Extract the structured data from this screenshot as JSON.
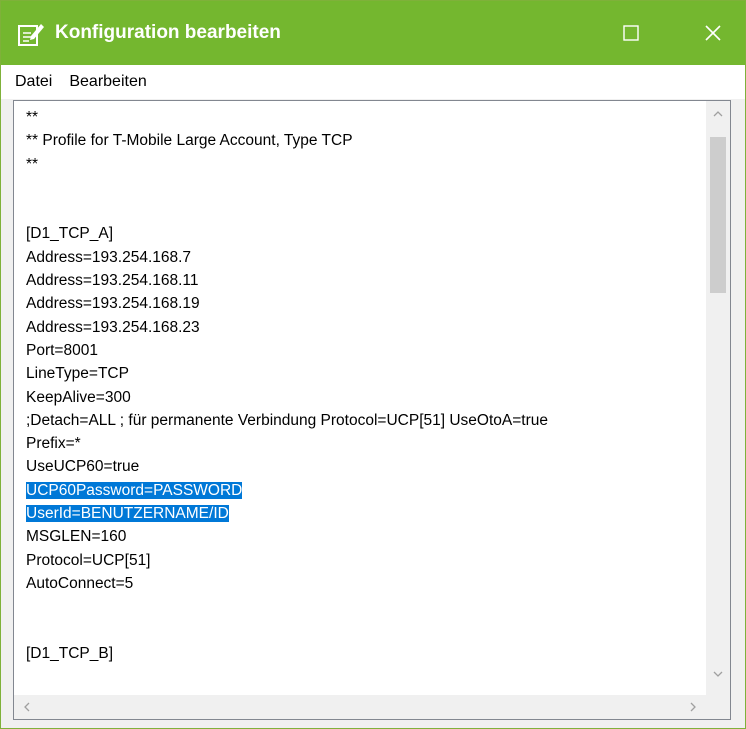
{
  "window": {
    "title": "Konfiguration bearbeiten",
    "accent_color": "#74b72f",
    "app_icon": "edit-document-icon",
    "maximize_icon": "maximize-icon",
    "close_icon": "close-icon"
  },
  "menu": {
    "items": [
      "Datei",
      "Bearbeiten"
    ]
  },
  "editor": {
    "selection_color": "#0078d7",
    "lines": [
      "**",
      "** Profile for T-Mobile Large Account, Type TCP",
      "**",
      "",
      "",
      "[D1_TCP_A]",
      "Address=193.254.168.7",
      "Address=193.254.168.11",
      "Address=193.254.168.19",
      "Address=193.254.168.23",
      "Port=8001",
      "LineType=TCP",
      "KeepAlive=300",
      ";Detach=ALL ; für permanente Verbindung Protocol=UCP[51] UseOtoA=true",
      "Prefix=*",
      "UseUCP60=true",
      "UCP60Password=PASSWORD",
      "UserId=BENUTZERNAME/ID",
      "MSGLEN=160",
      "Protocol=UCP[51]",
      "AutoConnect=5",
      "",
      "",
      "[D1_TCP_B]"
    ],
    "selected_lines": [
      16,
      17
    ]
  }
}
